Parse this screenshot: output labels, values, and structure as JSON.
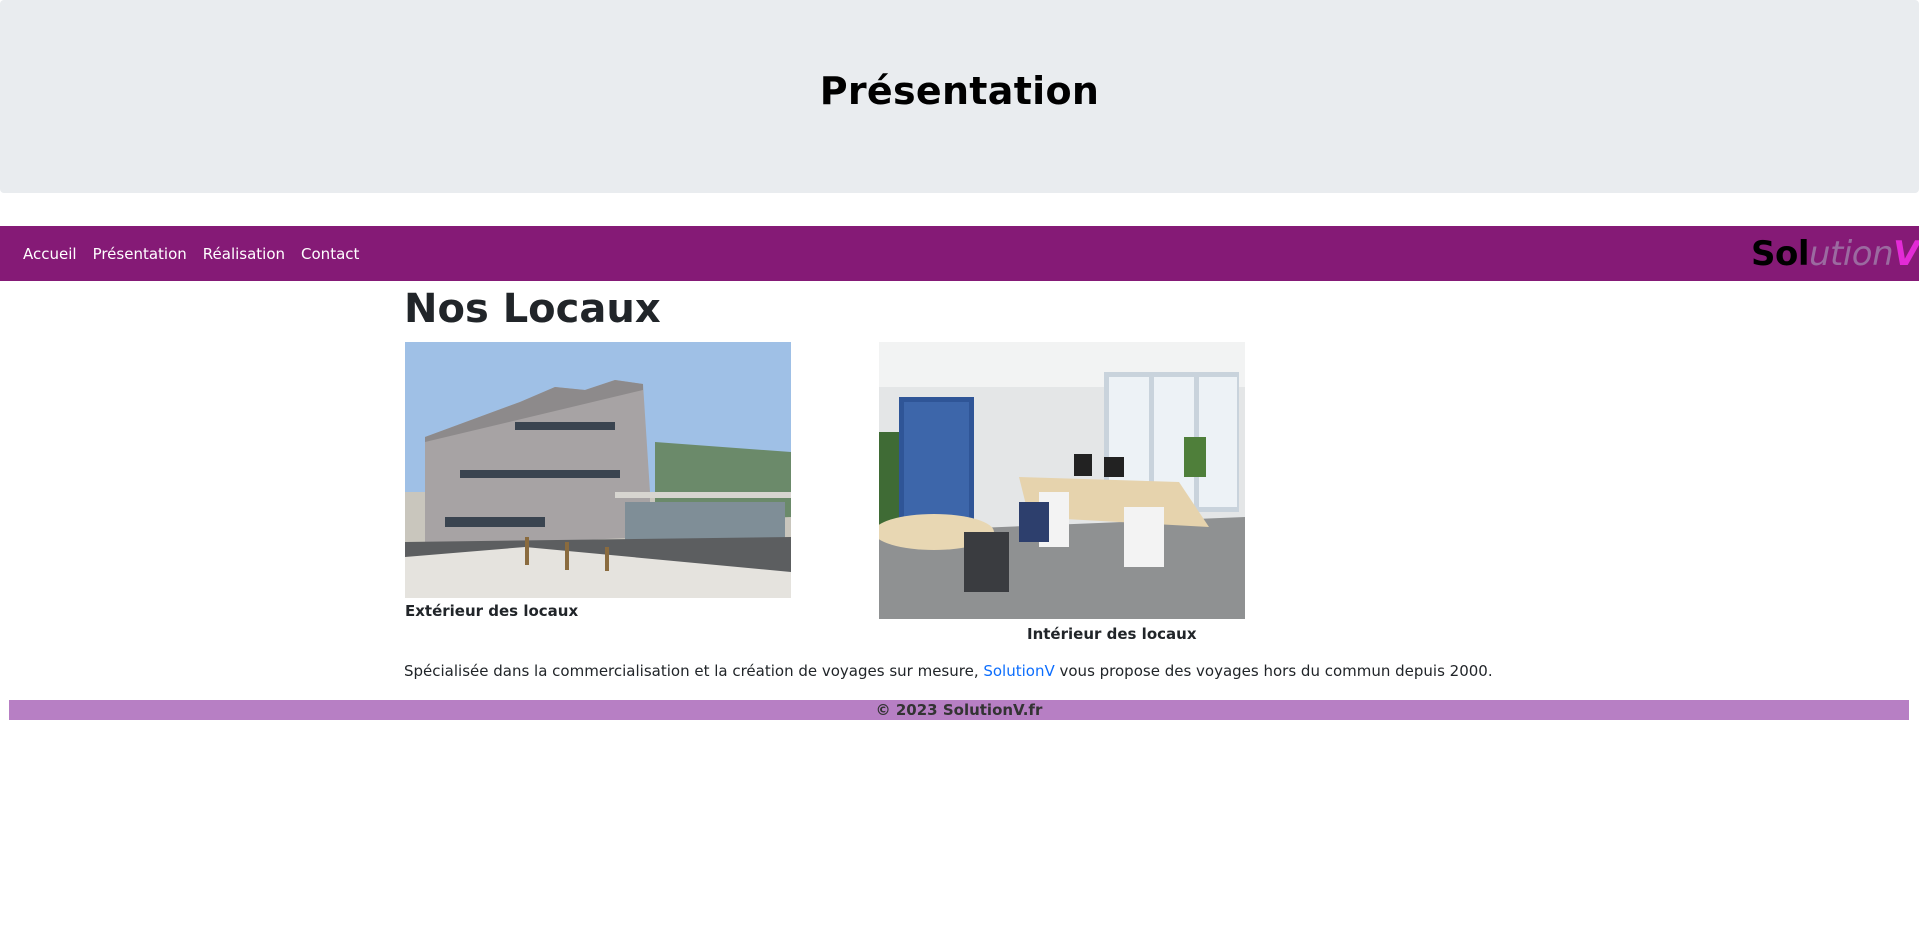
{
  "header": {
    "title": "Présentation"
  },
  "nav": {
    "links": [
      {
        "label": "Accueil"
      },
      {
        "label": "Présentation"
      },
      {
        "label": "Réalisation"
      },
      {
        "label": "Contact"
      }
    ],
    "brand": {
      "part1": "Sol",
      "part2": "ution",
      "part3": "V"
    }
  },
  "main": {
    "title": "Nos Locaux",
    "figures": [
      {
        "caption": "Extérieur des locaux"
      },
      {
        "caption": "Intérieur des locaux"
      }
    ],
    "paragraph": {
      "before": "Spécialisée dans la commercialisation et la création de voyages sur mesure, ",
      "link": "SolutionV",
      "after": " vous propose des voyages hors du commun depuis 2000."
    }
  },
  "footer": {
    "text": "© 2023 SolutionV.fr"
  },
  "colors": {
    "hero_bg": "#e9ecef",
    "navbar_bg": "#851a76",
    "footer_bg": "#b77fc4",
    "link": "#0d6efd",
    "brand_accent": "#e32bd6"
  }
}
